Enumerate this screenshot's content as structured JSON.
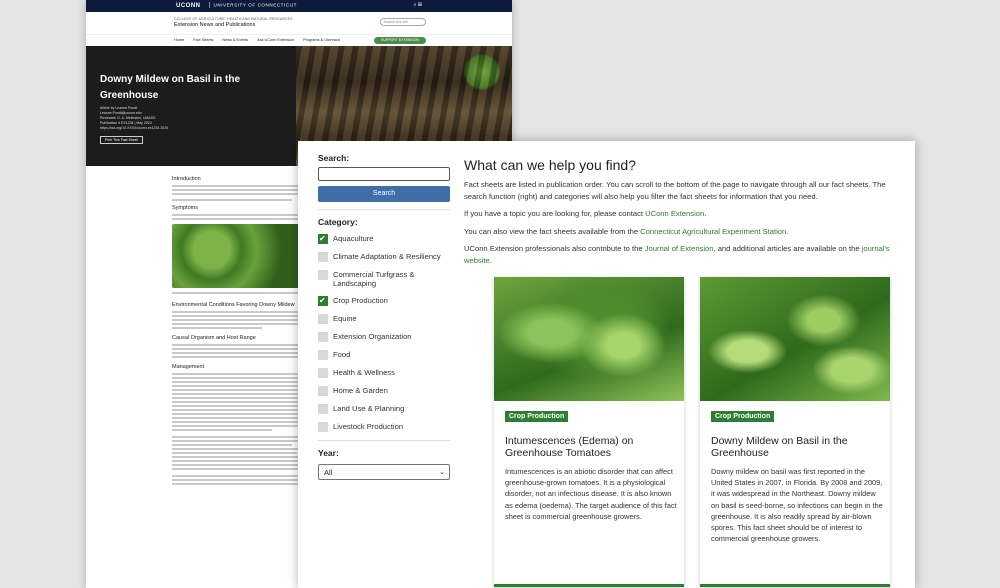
{
  "back_page": {
    "brand": "UCONN",
    "university": "UNIVERSITY OF CONNECTICUT",
    "college": "COLLEGE OF AGRICULTURE, HEALTH AND NATURAL RESOURCES",
    "site_title": "Extension News and Publications",
    "search_placeholder": "Search this site",
    "nav": [
      "Home",
      "Fact Sheets",
      "News & Events",
      "Ask UConn Extension",
      "Programs & Outreach"
    ],
    "support_button": "SUPPORT EXTENSION",
    "article_title": "Downy Mildew on Basil in the Greenhouse",
    "authors": [
      "Article by Leanne Pundt",
      "Leanne.Pundt@uconn.edu",
      "Reviewed: D. A. Melendez, UMASS",
      "Publication # EX1234 | May 2024",
      "https://doi.org/10.XXXX/uconn.ex1234.2024"
    ],
    "print_button": "Print This Fact Sheet",
    "sections": [
      "Introduction",
      "Symptoms",
      "Environmental Conditions Favoring Downy Mildew",
      "Causal Organism and Host Range",
      "Management"
    ]
  },
  "sidebar": {
    "search_label": "Search:",
    "search_value": "",
    "search_button": "Search",
    "category_label": "Category:",
    "categories": [
      {
        "label": "Aquaculture",
        "checked": true
      },
      {
        "label": "Climate Adaptation & Resiliency",
        "checked": false
      },
      {
        "label": "Commercial Turfgrass & Landscaping",
        "checked": false
      },
      {
        "label": "Crop Production",
        "checked": true
      },
      {
        "label": "Equine",
        "checked": false
      },
      {
        "label": "Extension Organization",
        "checked": false
      },
      {
        "label": "Food",
        "checked": false
      },
      {
        "label": "Health & Wellness",
        "checked": false
      },
      {
        "label": "Home & Garden",
        "checked": false
      },
      {
        "label": "Land Use & Planning",
        "checked": false
      },
      {
        "label": "Livestock Production",
        "checked": false
      }
    ],
    "year_label": "Year:",
    "year_value": "All"
  },
  "main": {
    "heading": "What can we help you find?",
    "p1": "Fact sheets are listed in publication order. You can scroll to the bottom of the page to navigate through all our fact sheets. The search function (right) and categories will also help you filter the fact sheets for information that you need.",
    "p2_pre": "If you have a topic you are looking for, please contact ",
    "p2_link": "UConn Extension",
    "p2_post": ".",
    "p3_pre": "You can also view the fact sheets available from the ",
    "p3_link": "Connecticut Agricultural Experiment Station",
    "p3_post": ".",
    "p4_pre": "UConn Extension professionals also contribute to the ",
    "p4_link1": "Journal of Extension",
    "p4_mid": ", and additional articles are available on the ",
    "p4_link2": "journal's website",
    "p4_post": "."
  },
  "cards": [
    {
      "badge": "Crop Production",
      "title": "Intumescences (Edema) on Greenhouse Tomatoes",
      "text": "Intumescences is an abiotic disorder that can affect greenhouse-grown tomatoes. It is a physiological disorder, not an infectious disease. It is also known as edema (oedema). The target audience of this fact sheet is commercial greenhouse growers."
    },
    {
      "badge": "Crop Production",
      "title": "Downy Mildew on Basil in the Greenhouse",
      "text": "Downy mildew on basil was first reported in the United States in 2007, in Florida. By 2008 and 2009, it was widespread in the Northeast. Downy mildew on basil is seed-borne, so infections can begin in the greenhouse. It is also readily spread by air-blown spores. This fact sheet should be of interest to commercial greenhouse growers."
    }
  ]
}
